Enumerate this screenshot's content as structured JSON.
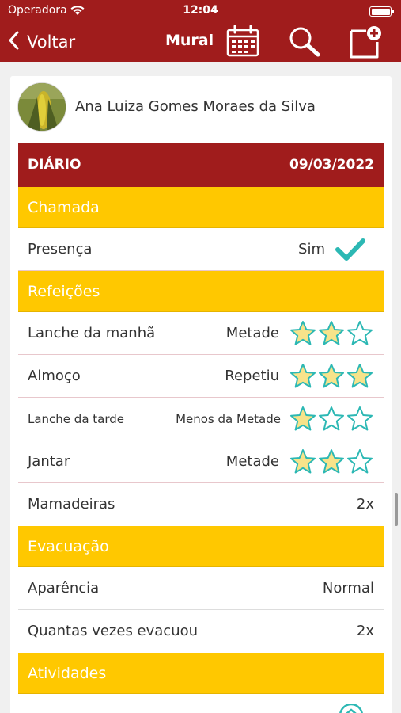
{
  "status_bar": {
    "carrier": "Operadora",
    "time": "12:04"
  },
  "nav": {
    "back_label": "Voltar",
    "title": "Mural"
  },
  "student": {
    "name": "Ana Luiza Gomes Moraes da Silva"
  },
  "diary": {
    "label": "DIÁRIO",
    "date": "09/03/2022"
  },
  "sections": {
    "chamada": "Chamada",
    "refeicoes": "Refeições",
    "evacuacao": "Evacuação",
    "atividades": "Atividades"
  },
  "presence": {
    "label": "Presença",
    "value": "Sim"
  },
  "meals": [
    {
      "label": "Lanche da manhã",
      "value": "Metade",
      "stars": 2
    },
    {
      "label": "Almoço",
      "value": "Repetiu",
      "stars": 3
    },
    {
      "label": "Lanche da tarde",
      "value": "Menos da Metade",
      "stars": 1
    },
    {
      "label": "Jantar",
      "value": "Metade",
      "stars": 2
    }
  ],
  "bottles": {
    "label": "Mamadeiras",
    "value": "2x"
  },
  "evacuation": [
    {
      "label": "Aparência",
      "value": "Normal"
    },
    {
      "label": "Quantas vezes evacuou",
      "value": "2x"
    }
  ],
  "colors": {
    "brand_red": "#a01c1c",
    "section_yellow": "#ffc800",
    "star_fill": "#f7e38a",
    "teal": "#2cb8b4"
  },
  "icons": {
    "back": "chevron-left-icon",
    "calendar": "calendar-icon",
    "search": "search-icon",
    "new_post": "add-note-icon",
    "check": "checkmark-icon",
    "star": "star-icon"
  }
}
